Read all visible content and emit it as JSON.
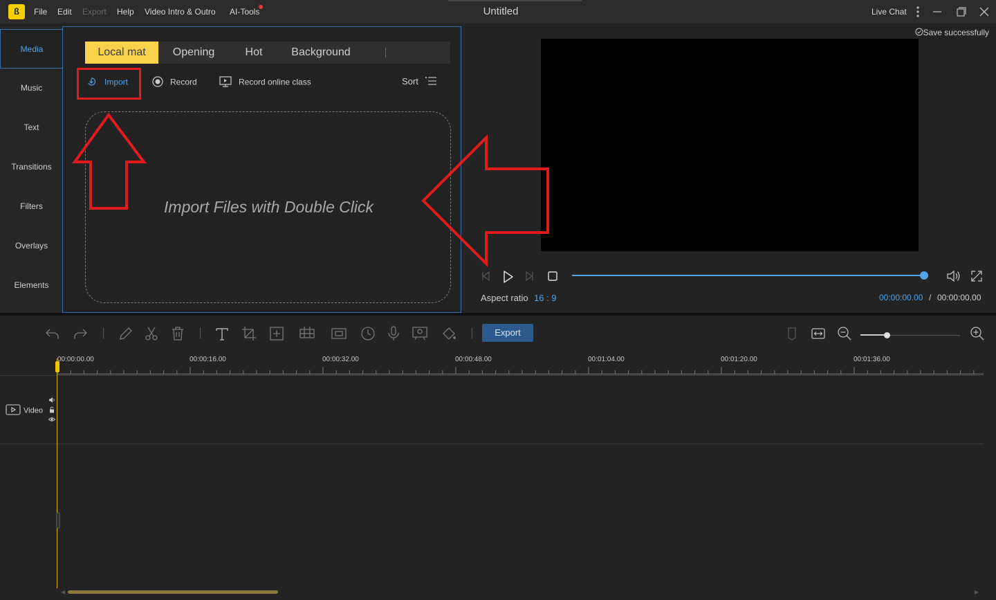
{
  "app": {
    "title": "Untitled",
    "logo_text": "ß"
  },
  "menu": {
    "file": "File",
    "edit": "Edit",
    "export": "Export",
    "help": "Help",
    "video_intro": "Video Intro & Outro",
    "ai_tools": "AI-Tools"
  },
  "titlebar": {
    "live_chat": "Live Chat"
  },
  "side_tabs": [
    "Media",
    "Music",
    "Text",
    "Transitions",
    "Filters",
    "Overlays",
    "Elements"
  ],
  "media": {
    "tabs": [
      "Local mat",
      "Opening",
      "Hot",
      "Background"
    ],
    "import_label": "Import",
    "record_label": "Record",
    "record_class_label": "Record online class",
    "sort_label": "Sort",
    "drop_hint": "Import Files with Double Click"
  },
  "preview": {
    "save_status": "Save successfully",
    "aspect_label": "Aspect ratio",
    "aspect_value": "16 : 9",
    "time_current": "00:00:00.00",
    "time_separator": "/",
    "time_total": "00:00:00.00",
    "progress": 1.0
  },
  "timeline": {
    "export_label": "Export",
    "ruler_labels": [
      "00:00:00.00",
      "00:00:16.00",
      "00:00:32.00",
      "00:00:48.00",
      "00:01:04.00",
      "00:01:20.00",
      "00:01:36.00"
    ],
    "video_track_label": "Video"
  },
  "colors": {
    "accent_blue": "#4fa3e8",
    "active_tab_yellow": "#f8d24a",
    "highlight_red": "#e01b1b",
    "playhead": "#f2c400"
  }
}
